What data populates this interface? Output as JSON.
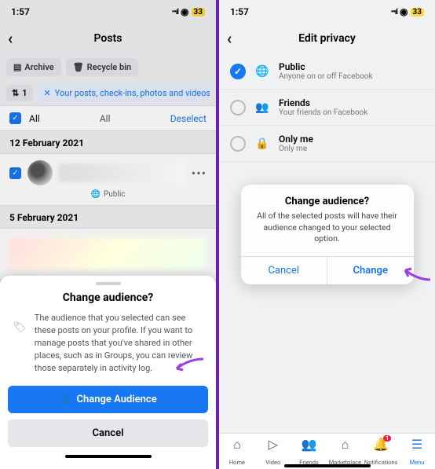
{
  "statusbar": {
    "time": "1:57",
    "battery": "33"
  },
  "left": {
    "header_title": "Posts",
    "toolbar": {
      "archive": "Archive",
      "recycle": "Recycle bin"
    },
    "filter": {
      "count": "1",
      "chip": "Your posts, check-ins, photos and videos"
    },
    "select": {
      "all_left": "All",
      "all_mid": "All",
      "deselect": "Deselect"
    },
    "dates": [
      "12 February 2021",
      "5 February 2021"
    ],
    "post_audience": "Public",
    "sheet": {
      "title": "Change audience?",
      "body": "The audience that you selected can see these posts on your profile. If you want to manage posts that you've shared in other places, such as in Groups, you can review those separately in activity log.",
      "primary": "Change Audience",
      "secondary": "Cancel"
    }
  },
  "right": {
    "header_title": "Edit privacy",
    "options": [
      {
        "title": "Public",
        "sub": "Anyone on or off Facebook",
        "icon": "globe",
        "selected": true
      },
      {
        "title": "Friends",
        "sub": "Your friends on Facebook",
        "icon": "friends",
        "selected": false
      },
      {
        "title": "Only me",
        "sub": "Only me",
        "icon": "lock",
        "selected": false
      }
    ],
    "alert": {
      "title": "Change audience?",
      "message": "All of the selected posts will have their audience changed to your selected option.",
      "cancel": "Cancel",
      "confirm": "Change"
    },
    "tabs": [
      {
        "label": "Home",
        "icon": "home"
      },
      {
        "label": "Video",
        "icon": "video"
      },
      {
        "label": "Friends",
        "icon": "friends"
      },
      {
        "label": "Marketplace",
        "icon": "market"
      },
      {
        "label": "Notifications",
        "icon": "bell",
        "badge": "1"
      },
      {
        "label": "Menu",
        "icon": "menu",
        "active": true
      }
    ]
  },
  "colors": {
    "accent": "#1877f2",
    "annotation": "#9c3ee8"
  }
}
